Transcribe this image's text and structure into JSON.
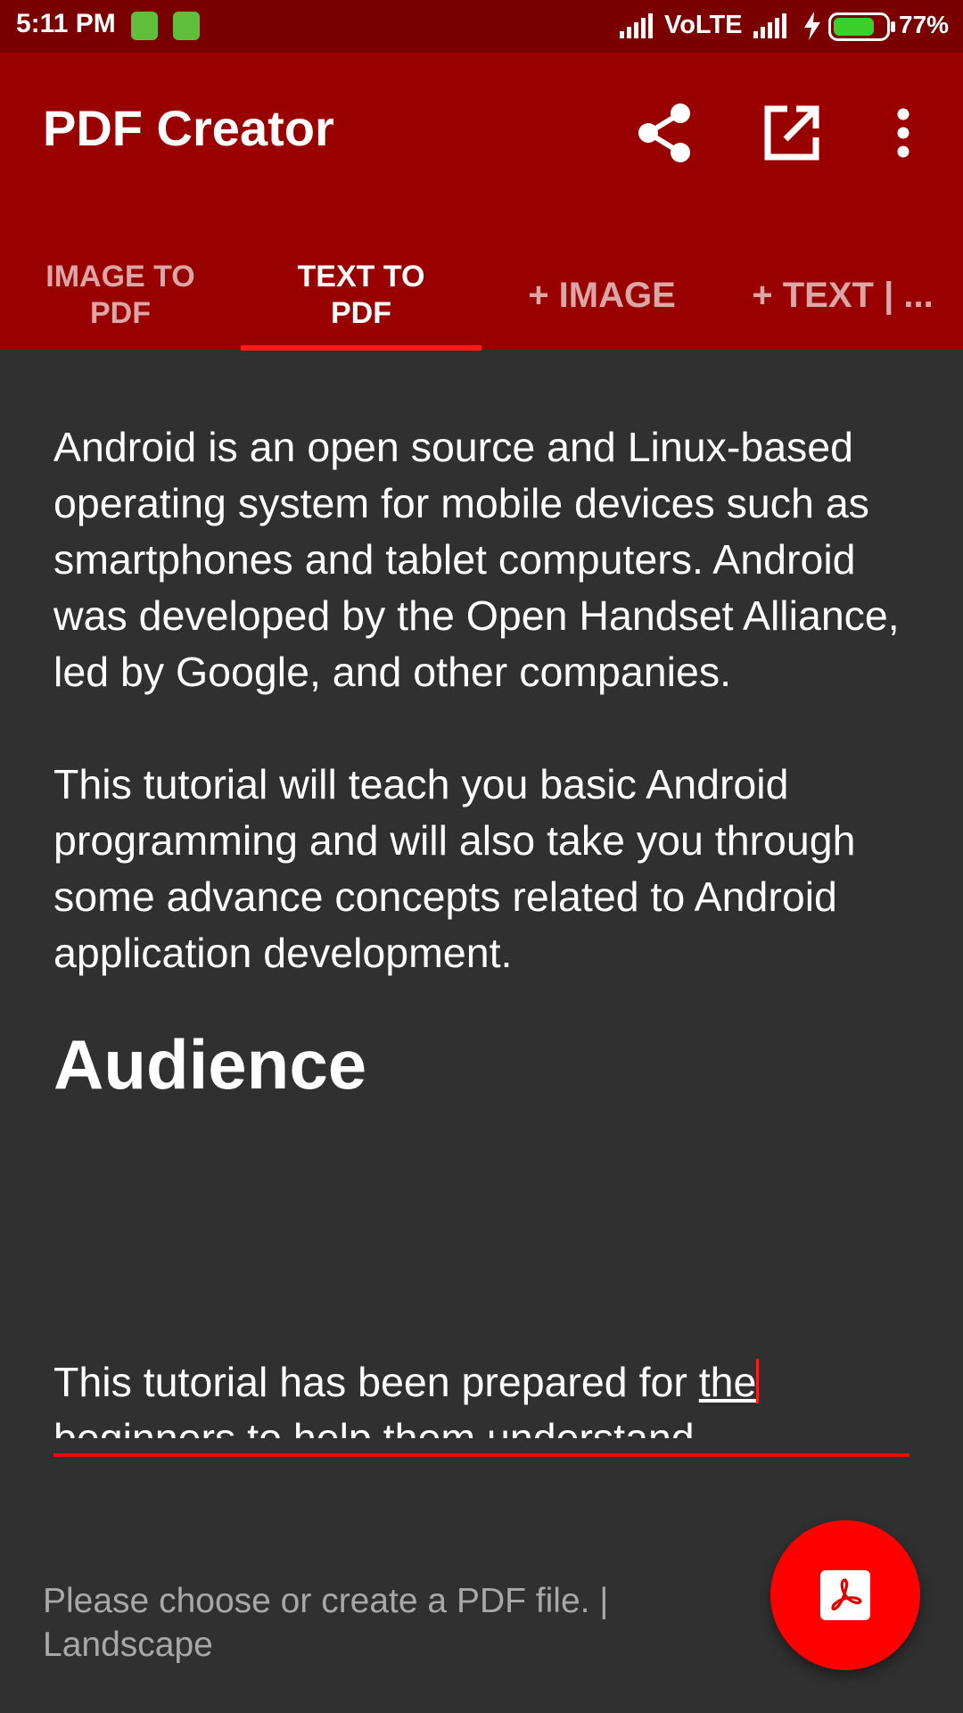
{
  "status_bar": {
    "time": "5:11 PM",
    "network": "VoLTE",
    "battery_percent": "77%",
    "battery_level": 0.77,
    "icons": [
      "battery-saver-icon",
      "android-notification-icon",
      "signal-icon",
      "signal-icon",
      "charging-icon",
      "battery-icon"
    ]
  },
  "app_bar": {
    "title": "PDF Creator",
    "actions": [
      "share-icon",
      "open-external-icon",
      "more-vert-icon"
    ]
  },
  "tabs": [
    {
      "line1": "IMAGE TO",
      "line2": "PDF",
      "selected": false
    },
    {
      "line1": "TEXT TO",
      "line2": "PDF",
      "selected": true
    },
    {
      "line1": "+ IMAGE",
      "line2": "",
      "selected": false
    },
    {
      "line1": "+ TEXT | ...",
      "line2": "",
      "selected": false
    }
  ],
  "editor": {
    "paragraph1": "Android is an open source and Linux-based operating system for mobile devices such as smartphones and tablet computers. Android was developed by the Open Handset Alliance, led by Google, and other companies.",
    "paragraph2": "This tutorial will teach you basic Android programming and will also take you through some advance concepts related to Android application development.",
    "heading": "Audience",
    "paragraph3_line1_start": "This tutorial has been prepared for ",
    "paragraph3_line1_underlined": "the",
    "paragraph3_line2": "beginners to help them understand"
  },
  "footer": {
    "status_text": "Please choose or create a PDF file. | Landscape"
  },
  "fab": {
    "icon": "pdf-icon"
  },
  "colors": {
    "status_bar": "#7a0000",
    "app_bar": "#990000",
    "tab_indicator": "#ff1a1a",
    "background": "#303030",
    "fab": "#ff0000"
  }
}
